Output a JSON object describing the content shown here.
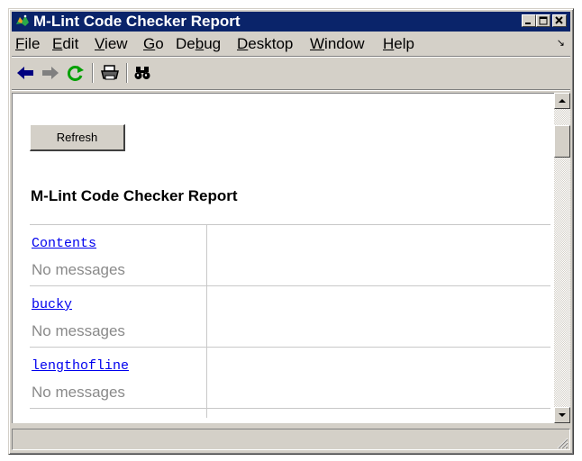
{
  "window": {
    "title": "M-Lint Code Checker Report"
  },
  "menu": {
    "items": [
      {
        "label": "File",
        "mnemonic": "F",
        "rest": "ile"
      },
      {
        "label": "Edit",
        "mnemonic": "E",
        "rest": "dit"
      },
      {
        "label": "View",
        "mnemonic": "V",
        "rest": "iew"
      },
      {
        "label": "Go",
        "mnemonic": "G",
        "rest": "o"
      },
      {
        "label": "Debug",
        "pre": "De",
        "mnemonic": "b",
        "rest": "ug"
      },
      {
        "label": "Desktop",
        "mnemonic": "D",
        "rest": "esktop"
      },
      {
        "label": "Window",
        "mnemonic": "W",
        "rest": "indow"
      },
      {
        "label": "Help",
        "mnemonic": "H",
        "rest": "elp"
      }
    ]
  },
  "toolbar": {
    "icons": [
      "back-arrow-icon",
      "forward-arrow-icon",
      "refresh-icon",
      "print-icon",
      "find-binoculars-icon"
    ],
    "colors": {
      "back": "#000080",
      "forward": "#808080",
      "refresh": "#00a000"
    }
  },
  "content": {
    "refresh_label": "Refresh",
    "report_title": "M-Lint Code Checker Report",
    "files": [
      {
        "name": "Contents",
        "message": "No messages"
      },
      {
        "name": "bucky",
        "message": "No messages"
      },
      {
        "name": "lengthofline",
        "message": "No messages"
      }
    ]
  },
  "theme": {
    "titlebar": "#0a246a",
    "chrome": "#d4d0c8",
    "link": "#0000ee",
    "muted": "#8a8a8a"
  }
}
